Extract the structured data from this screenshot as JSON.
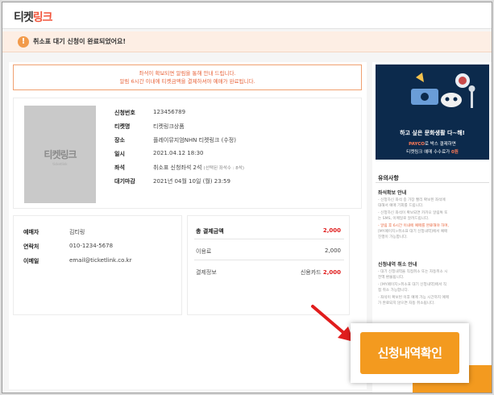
{
  "brand": {
    "part1": "티켓",
    "part2": "링크"
  },
  "notice": {
    "icon": "!",
    "text": "취소표 대기 신청이 완료되었어요!"
  },
  "warning": {
    "line1": "좌석이 확보되면 알림을 통해 안내 드립니다.",
    "line2": "알림 6시간 이내에 티켓금액을 결제하셔야 예매가 완료됩니다."
  },
  "poster": {
    "title": "티켓링크",
    "subtitle": "ticketlink"
  },
  "details": [
    {
      "label": "신청번호",
      "value": "123456789"
    },
    {
      "label": "티켓명",
      "value": "티켓링크상품"
    },
    {
      "label": "장소",
      "value": "플레이뮤지엄NHN 티켓링크 (수정)"
    },
    {
      "label": "일시",
      "value": "2021.04.12 18:30"
    },
    {
      "label": "좌석",
      "value": "취소표 신청좌석 2석",
      "note": "(선택된 좌석수 : 8석)"
    },
    {
      "label": "대기마감",
      "value": "2021년 04월 10일 (월) 23:59"
    }
  ],
  "booker": [
    {
      "label": "예매자",
      "value": "김티링"
    },
    {
      "label": "연락처",
      "value": "010-1234-5678"
    },
    {
      "label": "이메일",
      "value": "email@ticketlink.co.kr"
    }
  ],
  "payment": {
    "total_label": "총 결제금액",
    "total_value": "2,000",
    "fee_label": "이용료",
    "fee_value": "2,000",
    "info_label": "결제정보",
    "info_method": "신용카드",
    "info_value": "2,000"
  },
  "banner": {
    "line1": "하고 싶은 문화생활 다~해!",
    "line2_highlight": "PAYCO",
    "line2_rest": "로 박스 결제하면",
    "line3_rest": "티켓링크 예매 수수료가",
    "line3_highlight": "0원"
  },
  "side": {
    "title": "유의사항",
    "section1_title": "좌석확보 안내",
    "section1_lines": [
      "- 신청하신 좌석 중 가장 빨리 확보된 좌석에",
      "대해서 예매 기회를 드립니다.",
      "- 신청하신 좌석이 확보되면 카카오 알림톡 또",
      "는 SMS, 이메일로 알려드립니다.",
      "- 알림 후 6시간 이내에 예매를 완료해야 하며,",
      "[MY페이지>취소표 대기 신청내역]에서 예매",
      "진행이 가능합니다."
    ],
    "section2_title": "신청내역 취소 안내",
    "section2_lines": [
      "- 대기 신청내역을 직접취소 또는 자동취소 시",
      "전액 환불됩니다.",
      "- [MY페이지>취소표 대기 신청내역]에서 직",
      "접 취소 가능합니다.",
      "- 좌석이 확보된 이후 예매 가능 시간까지 예매",
      "가 완료되지 않으면 자동 취소됩니다."
    ]
  },
  "confirm_button": "신청내역확인",
  "colors": {
    "accent": "#f39a1f",
    "brand": "#f2563d",
    "warning": "#e8663d",
    "price": "#e02020"
  }
}
